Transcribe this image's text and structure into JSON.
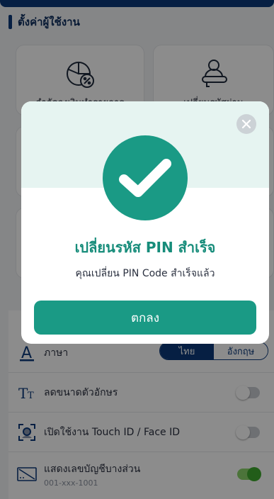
{
  "section_title": "ตั้งค่าผู้ใช้งาน",
  "tiles": [
    {
      "label": "จำกัดวงเงินทำรายการ",
      "icon": "pie-chart-percent-icon"
    },
    {
      "label": "เปลี่ยนรหัสผ่าน",
      "icon": "user-key-icon"
    }
  ],
  "settings": {
    "language": {
      "label": "ภาษา",
      "options": [
        "ไทย",
        "อังกฤษ"
      ],
      "selected": "ไทย"
    },
    "font_size": {
      "label": "ลดขนาดตัวอักษร",
      "enabled": false
    },
    "biometric": {
      "label": "เปิดใช้งาน Touch ID / Face ID",
      "enabled": false
    },
    "partial_account": {
      "label": "แสดงเลขบัญชีบางส่วน",
      "example": "001-xxx-1001",
      "enabled": true
    }
  },
  "modal": {
    "title": "เปลี่ยนรหัส PIN สำเร็จ",
    "message": "คุณเปลี่ยน PIN Code สำเร็จแล้ว",
    "ok_label": "ตกลง"
  },
  "colors": {
    "primary": "#0c3a7a",
    "success": "#1a9a85",
    "toggle_on": "#3faa2e"
  }
}
